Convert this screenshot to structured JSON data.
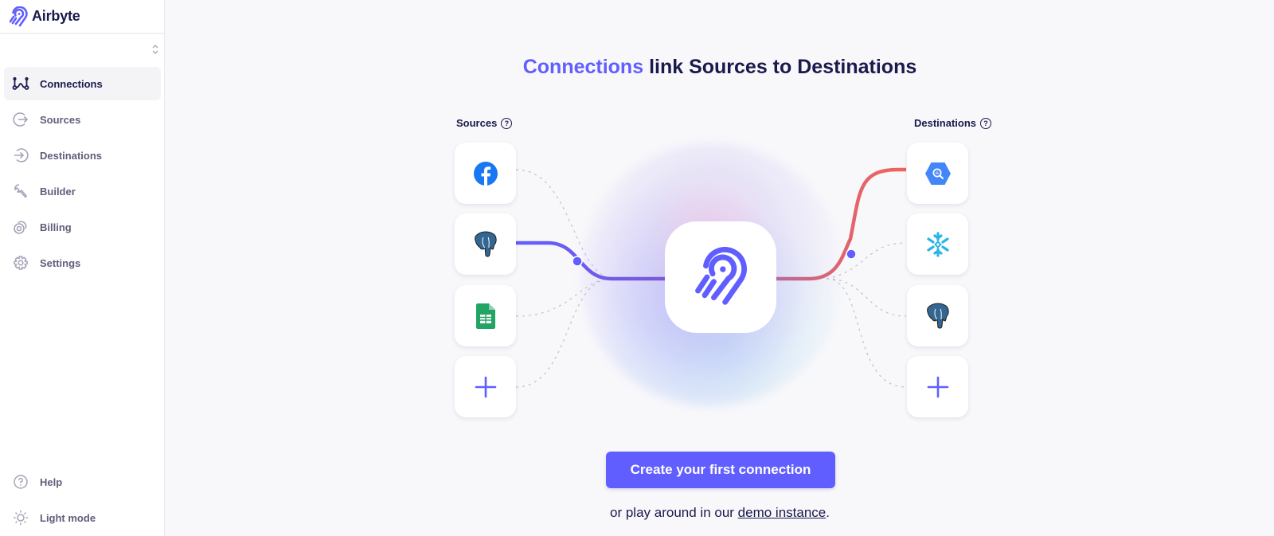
{
  "app": {
    "name": "Airbyte"
  },
  "sidebar": {
    "items": [
      {
        "label": "Connections",
        "icon": "connections-icon",
        "active": true
      },
      {
        "label": "Sources",
        "icon": "sources-icon",
        "active": false
      },
      {
        "label": "Destinations",
        "icon": "destinations-icon",
        "active": false
      },
      {
        "label": "Builder",
        "icon": "builder-wrench-icon",
        "active": false
      },
      {
        "label": "Billing",
        "icon": "billing-coins-icon",
        "active": false
      },
      {
        "label": "Settings",
        "icon": "gear-icon",
        "active": false
      }
    ],
    "bottom_items": [
      {
        "label": "Help",
        "icon": "help-icon"
      },
      {
        "label": "Light mode",
        "icon": "sun-icon"
      }
    ]
  },
  "main": {
    "headline": {
      "accent": "Connections",
      "rest": " link Sources to Destinations"
    },
    "sources_label": "Sources",
    "destinations_label": "Destinations",
    "sources": [
      {
        "name": "Facebook",
        "icon": "facebook-icon"
      },
      {
        "name": "Postgres",
        "icon": "postgres-elephant-icon"
      },
      {
        "name": "Google Sheets",
        "icon": "google-sheets-icon"
      },
      {
        "name": "Add source",
        "icon": "plus-icon"
      }
    ],
    "destinations": [
      {
        "name": "BigQuery",
        "icon": "bigquery-icon"
      },
      {
        "name": "Snowflake",
        "icon": "snowflake-icon"
      },
      {
        "name": "Postgres",
        "icon": "postgres-elephant-icon"
      },
      {
        "name": "Add destination",
        "icon": "plus-icon"
      }
    ],
    "cta_label": "Create your first connection",
    "subtext_prefix": "or play around in our ",
    "subtext_link": "demo instance",
    "subtext_suffix": "."
  },
  "colors": {
    "accent": "#615eff",
    "text_dark": "#1a194d",
    "destination_wire": "#f0645a"
  }
}
